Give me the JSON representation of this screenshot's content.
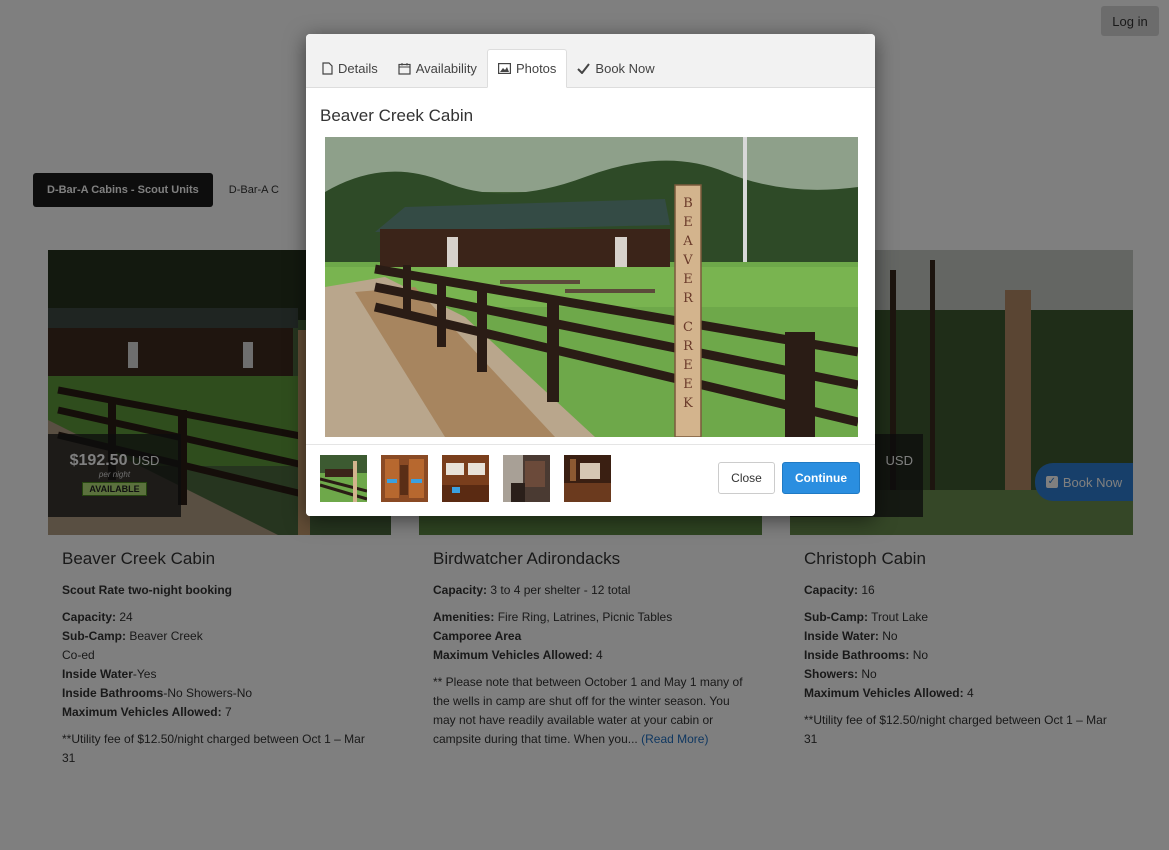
{
  "header": {
    "login_label": "Log in"
  },
  "category_tabs": [
    {
      "label": "D-Bar-A Cabins - Scout Units",
      "active": true
    },
    {
      "label": "D-Bar-A C"
    }
  ],
  "cards": [
    {
      "title": "Beaver Creek Cabin",
      "price": "$192.50",
      "currency": "USD",
      "price_sub": "per night",
      "availability": "AVAILABLE",
      "lines": [
        {
          "label": "Scout Rate two-night booking",
          "value": ""
        },
        {
          "label": "Capacity:",
          "value": " 24"
        },
        {
          "label": "Sub-Camp:",
          "value": " Beaver Creek"
        },
        {
          "label": "",
          "value": "Co-ed"
        },
        {
          "label": "Inside Water",
          "value": "-Yes"
        },
        {
          "label": "Inside Bathrooms",
          "value": "-No Showers-No"
        },
        {
          "label": "Maximum Vehicles Allowed:",
          "value": " 7"
        }
      ],
      "note": "**Utility fee of $12.50/night charged between Oct 1 – Mar 31"
    },
    {
      "title": "Birdwatcher Adirondacks",
      "lines": [
        {
          "label": "Capacity:",
          "value": " 3 to 4 per shelter - 12 total"
        },
        {
          "label": "Amenities:",
          "value": " Fire Ring, Latrines, Picnic Tables"
        },
        {
          "label": "Camporee Area",
          "value": ""
        },
        {
          "label": "Maximum Vehicles Allowed:",
          "value": " 4"
        }
      ],
      "note": "** Please note that between October 1 and May 1 many of the wells in camp are shut off for the winter season. You may not have readily available water at your cabin or campsite during that time. When you...",
      "read_more": "(Read More)"
    },
    {
      "title": "Christoph Cabin",
      "currency": "USD",
      "book_now_label": "Book Now",
      "lines": [
        {
          "label": "Capacity:",
          "value": " 16"
        },
        {
          "label": "Sub-Camp:",
          "value": " Trout Lake"
        },
        {
          "label": "Inside Water:",
          "value": " No"
        },
        {
          "label": "Inside Bathrooms:",
          "value": " No"
        },
        {
          "label": "Showers:",
          "value": " No"
        },
        {
          "label": "Maximum Vehicles Allowed:",
          "value": " 4"
        }
      ],
      "note": "**Utility fee of $12.50/night charged between Oct 1 – Mar 31"
    }
  ],
  "modal": {
    "tabs": [
      {
        "label": "Details",
        "icon": "file-icon"
      },
      {
        "label": "Availability",
        "icon": "calendar-icon"
      },
      {
        "label": "Photos",
        "icon": "image-icon",
        "active": true
      },
      {
        "label": "Book Now",
        "icon": "check-icon"
      }
    ],
    "title": "Beaver Creek Cabin",
    "sign_letters": "BEAVER CREEK",
    "thumb_count": 5,
    "close_label": "Close",
    "continue_label": "Continue"
  }
}
